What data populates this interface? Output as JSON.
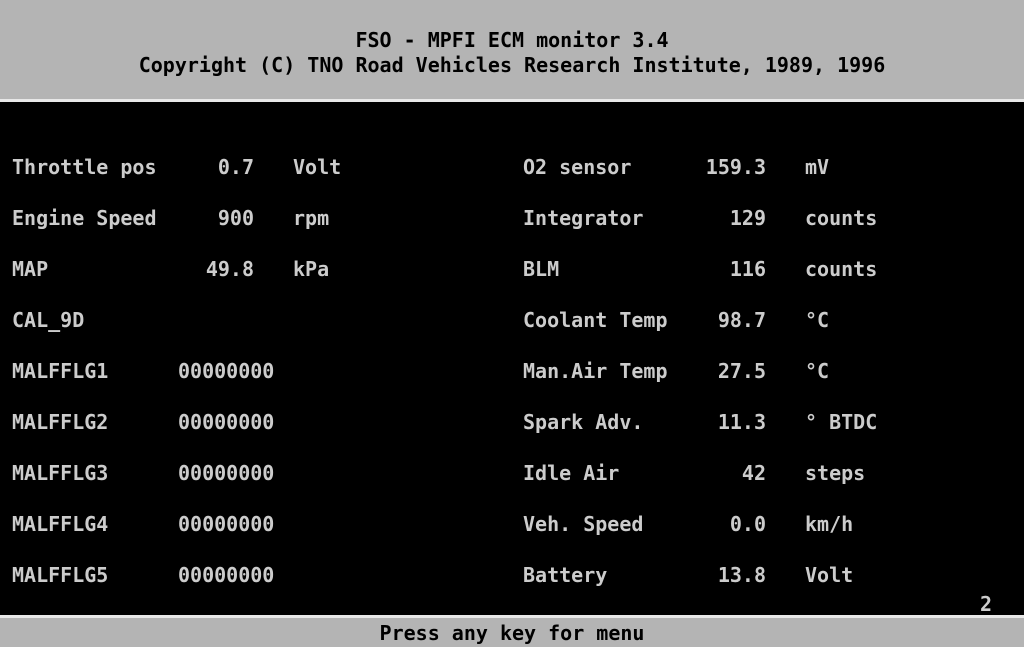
{
  "header": {
    "title": "FSO - MPFI ECM monitor 3.4",
    "copyright": "Copyright (C) TNO Road Vehicles Research Institute, 1989, 1996"
  },
  "left": [
    {
      "label": "Throttle pos",
      "value": "0.7",
      "unit": "Volt"
    },
    {
      "label": "Engine Speed",
      "value": "900",
      "unit": "rpm"
    },
    {
      "label": "MAP",
      "value": "49.8",
      "unit": "kPa"
    },
    {
      "label": "CAL_9D",
      "value": "",
      "unit": ""
    },
    {
      "label": "MALFFLG1",
      "value": "00000000",
      "unit": ""
    },
    {
      "label": "MALFFLG2",
      "value": "00000000",
      "unit": ""
    },
    {
      "label": "MALFFLG3",
      "value": "00000000",
      "unit": ""
    },
    {
      "label": "MALFFLG4",
      "value": "00000000",
      "unit": ""
    },
    {
      "label": "MALFFLG5",
      "value": "00000000",
      "unit": ""
    }
  ],
  "right": [
    {
      "label": "O2 sensor",
      "value": "159.3",
      "unit": "mV"
    },
    {
      "label": "Integrator",
      "value": "129",
      "unit": "counts"
    },
    {
      "label": "BLM",
      "value": "116",
      "unit": "counts"
    },
    {
      "label": "Coolant Temp",
      "value": "98.7",
      "unit": "°C"
    },
    {
      "label": "Man.Air Temp",
      "value": "27.5",
      "unit": "°C"
    },
    {
      "label": "Spark Adv.",
      "value": "11.3",
      "unit": "° BTDC"
    },
    {
      "label": "Idle Air",
      "value": "42",
      "unit": "steps"
    },
    {
      "label": "Veh. Speed",
      "value": "0.0",
      "unit": "km/h"
    },
    {
      "label": "Battery",
      "value": "13.8",
      "unit": "Volt"
    }
  ],
  "page_number": "2",
  "footer": {
    "prompt": "Press any key for menu"
  },
  "colors": {
    "background": "#000000",
    "bar": "#b4b4b4",
    "text": "#cccccc"
  }
}
